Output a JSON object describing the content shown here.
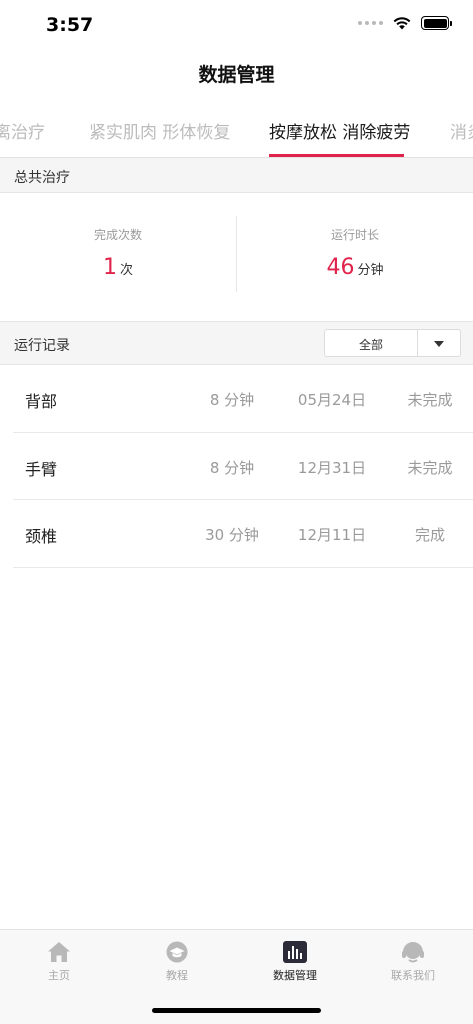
{
  "status_bar": {
    "time": "3:57"
  },
  "nav": {
    "title": "数据管理"
  },
  "tabs": [
    {
      "label": "离治疗",
      "active": false
    },
    {
      "label": "紧实肌肉 形体恢复",
      "active": false
    },
    {
      "label": "按摩放松 消除疲劳",
      "active": true
    },
    {
      "label": "消炎",
      "active": false
    }
  ],
  "total_section": {
    "title": "总共治疗"
  },
  "stats": {
    "count": {
      "label": "完成次数",
      "value": "1",
      "unit": "次"
    },
    "duration": {
      "label": "运行时长",
      "value": "46",
      "unit": "分钟"
    }
  },
  "records_section": {
    "title": "运行记录",
    "filter": {
      "selected": "全部"
    }
  },
  "records": [
    {
      "part": "背部",
      "duration": "8 分钟",
      "date": "05月24日",
      "status": "未完成"
    },
    {
      "part": "手臂",
      "duration": "8 分钟",
      "date": "12月31日",
      "status": "未完成"
    },
    {
      "part": "颈椎",
      "duration": "30 分钟",
      "date": "12月11日",
      "status": "完成"
    }
  ],
  "tabbar": [
    {
      "label": "主页",
      "icon": "home-icon",
      "active": false
    },
    {
      "label": "教程",
      "icon": "graduation-cap-icon",
      "active": false
    },
    {
      "label": "数据管理",
      "icon": "bar-chart-icon",
      "active": true
    },
    {
      "label": "联系我们",
      "icon": "headset-icon",
      "active": false
    }
  ],
  "colors": {
    "accent": "#e0234b",
    "text_muted": "#9a9a9a",
    "section_bg": "#f5f5f5"
  }
}
